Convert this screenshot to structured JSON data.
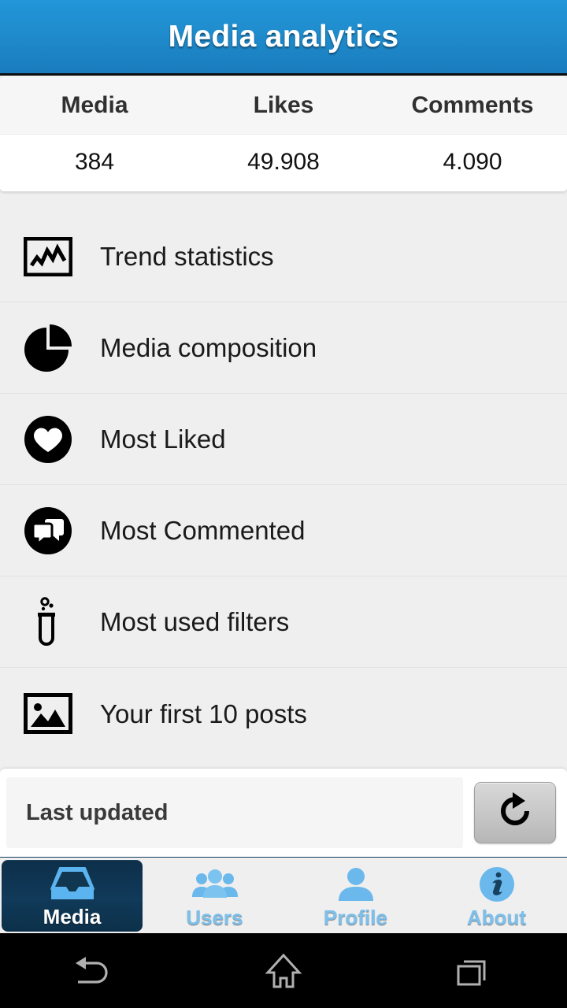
{
  "header": {
    "title": "Media analytics"
  },
  "stats": {
    "columns": [
      "Media",
      "Likes",
      "Comments"
    ],
    "values": [
      "384",
      "49.908",
      "4.090"
    ]
  },
  "menu": {
    "items": [
      {
        "label": "Trend statistics",
        "icon": "trend-chart-icon"
      },
      {
        "label": "Media composition",
        "icon": "pie-chart-icon"
      },
      {
        "label": "Most Liked",
        "icon": "heart-circle-icon"
      },
      {
        "label": "Most Commented",
        "icon": "comments-circle-icon"
      },
      {
        "label": "Most used filters",
        "icon": "test-tube-icon"
      },
      {
        "label": "Your first 10 posts",
        "icon": "photo-frame-icon"
      }
    ]
  },
  "footer": {
    "last_updated_label": "Last updated",
    "refresh_icon": "refresh-icon"
  },
  "tabs": [
    {
      "label": "Media",
      "icon": "inbox-tray-icon",
      "active": true
    },
    {
      "label": "Users",
      "icon": "users-group-icon",
      "active": false
    },
    {
      "label": "Profile",
      "icon": "person-icon",
      "active": false
    },
    {
      "label": "About",
      "icon": "info-circle-icon",
      "active": false
    }
  ],
  "navbar": {
    "back": "back-arrow-icon",
    "home": "home-icon",
    "recents": "recents-icon"
  },
  "colors": {
    "header_blue": "#1f8ccd",
    "tabbar_blue": "#176ba3",
    "tab_active_navy": "#103a59",
    "tab_label_blue": "#7cc0ec",
    "page_background": "#efefef"
  }
}
